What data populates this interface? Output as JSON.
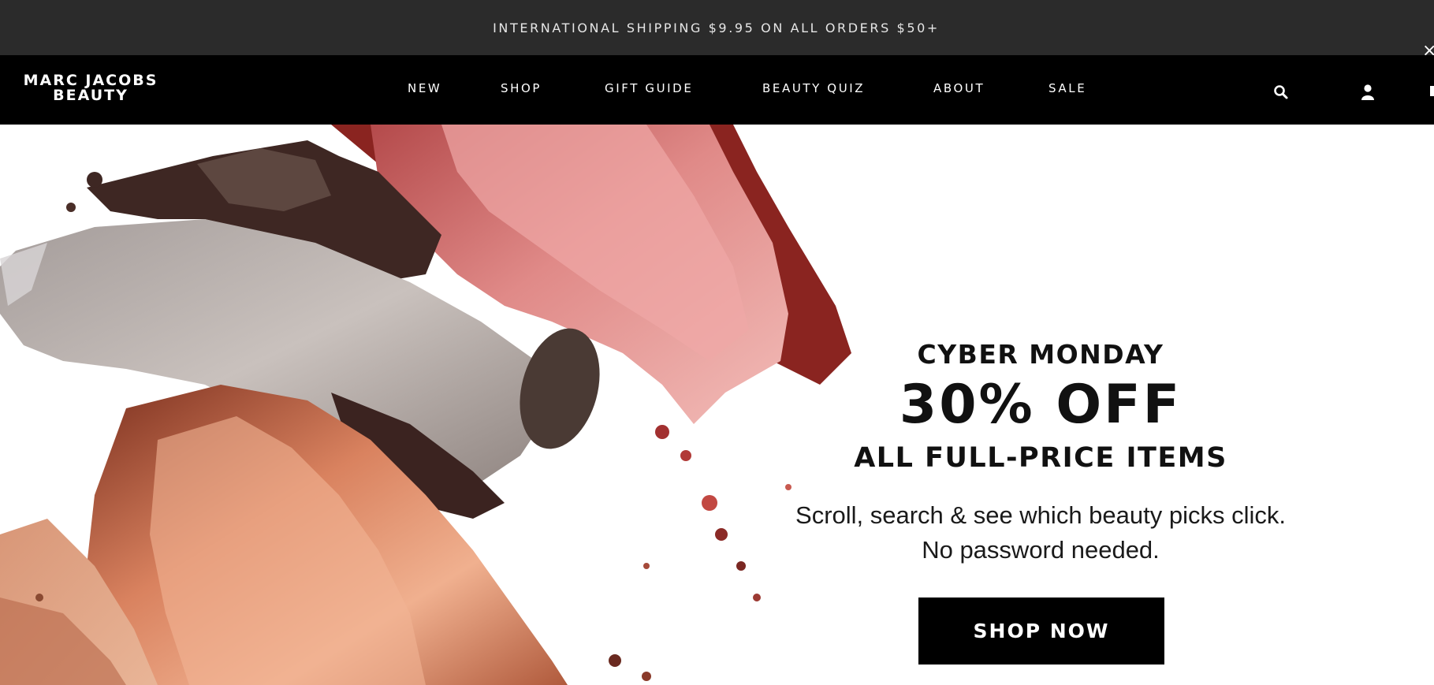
{
  "promo": {
    "text": "INTERNATIONAL SHIPPING $9.95 ON ALL ORDERS $50+"
  },
  "header": {
    "logo_line1": "MARC JACOBS",
    "logo_line2": "BEAUTY",
    "nav": [
      "NEW",
      "SHOP",
      "GIFT GUIDE",
      "BEAUTY QUIZ",
      "ABOUT",
      "SALE"
    ],
    "icons": [
      "search-icon",
      "account-icon",
      "bag-icon",
      "close-icon"
    ]
  },
  "hero": {
    "eyebrow": "CYBER MONDAY",
    "headline": "30% OFF",
    "subheadline": "ALL FULL-PRICE ITEMS",
    "body_line1": "Scroll, search & see which beauty picks click.",
    "body_line2": "No password needed.",
    "cta": "SHOP NOW"
  },
  "colors": {
    "promo_bg": "#2b2b2b",
    "header_bg": "#000000",
    "cta_bg": "#000000",
    "text_dark": "#111111"
  }
}
